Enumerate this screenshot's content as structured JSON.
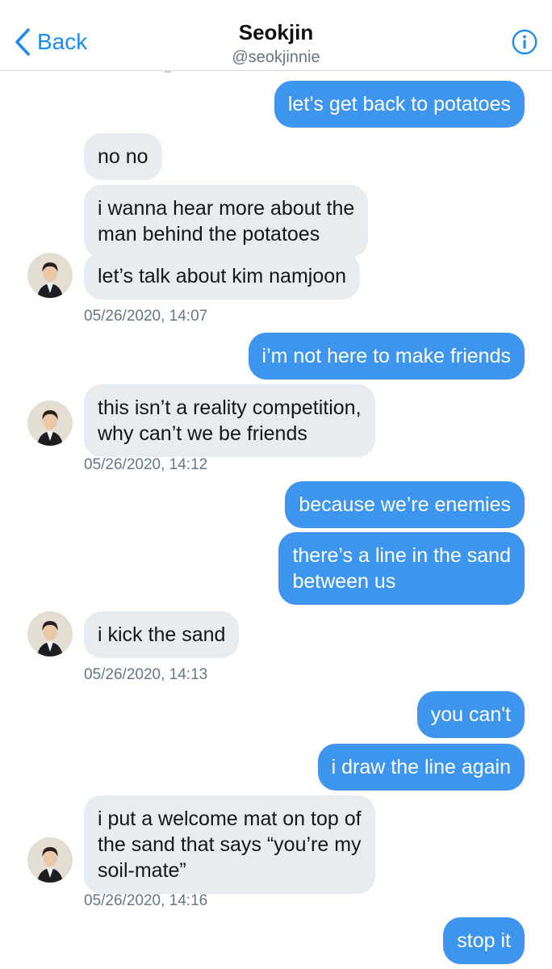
{
  "header": {
    "back_label": "Back",
    "title": "Seokjin",
    "handle": "@seokjinnie"
  },
  "messages": [
    {
      "text": "let’s get back to potatoes"
    },
    {
      "text": "no no"
    },
    {
      "line1": "i wanna hear more about the",
      "line2": "man behind the potatoes"
    },
    {
      "text": "let’s talk about kim namjoon"
    },
    {
      "text": "i’m not here to make friends"
    },
    {
      "line1": "this isn’t a reality competition,",
      "line2": "why can’t we be friends"
    },
    {
      "text": "because we’re enemies"
    },
    {
      "line1": "there’s a line in the sand",
      "line2": "between us"
    },
    {
      "text": "i kick the sand"
    },
    {
      "text": "you can't"
    },
    {
      "text": "i draw the line again"
    },
    {
      "line1": "i put a welcome mat on top of",
      "line2": "the sand that says “you’re my",
      "line3": "soil-mate”"
    },
    {
      "text": "stop it"
    }
  ],
  "timestamps": [
    "05/26/2020, 14:07",
    "05/26/2020, 14:12",
    "05/26/2020, 14:13",
    "05/26/2020, 14:16"
  ],
  "colors": {
    "accent": "#1d8cf0",
    "outgoing_bubble": "#3d95ee",
    "incoming_bubble": "#e6ecf0",
    "timestamp": "#657786"
  },
  "icons": {
    "back": "chevron-left-icon",
    "info": "info-icon",
    "avatar": "avatar"
  }
}
